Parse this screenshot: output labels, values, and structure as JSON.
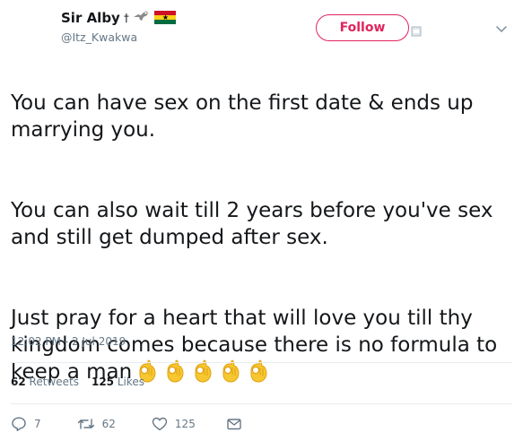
{
  "user": {
    "display_name": "Sir Alby",
    "cross": "†",
    "handle": "@Itz_Kwakwa"
  },
  "follow": {
    "label": "Follow"
  },
  "tweet": {
    "p1": "You can have sex on the first date & ends up marrying you.",
    "p2": "You can also wait till 2 years before you've sex and still get dumped after sex.",
    "p3": "Just pray for a heart that will love you till thy kingdom comes because there is no formula to keep a man",
    "emoji_count": 5,
    "emoji_name": "ok-hand-icon"
  },
  "timestamp": "12:02 PM - 2 Jul 2019",
  "stats": {
    "retweets_count": "62",
    "retweets_label": "Retweets",
    "likes_count": "125",
    "likes_label": "Likes"
  },
  "actions": {
    "replies": "7",
    "retweets": "62",
    "likes": "125"
  },
  "colors": {
    "follow": "#e0245e",
    "text": "#14171a",
    "muted": "#657786",
    "divider": "#e6ecf0"
  }
}
